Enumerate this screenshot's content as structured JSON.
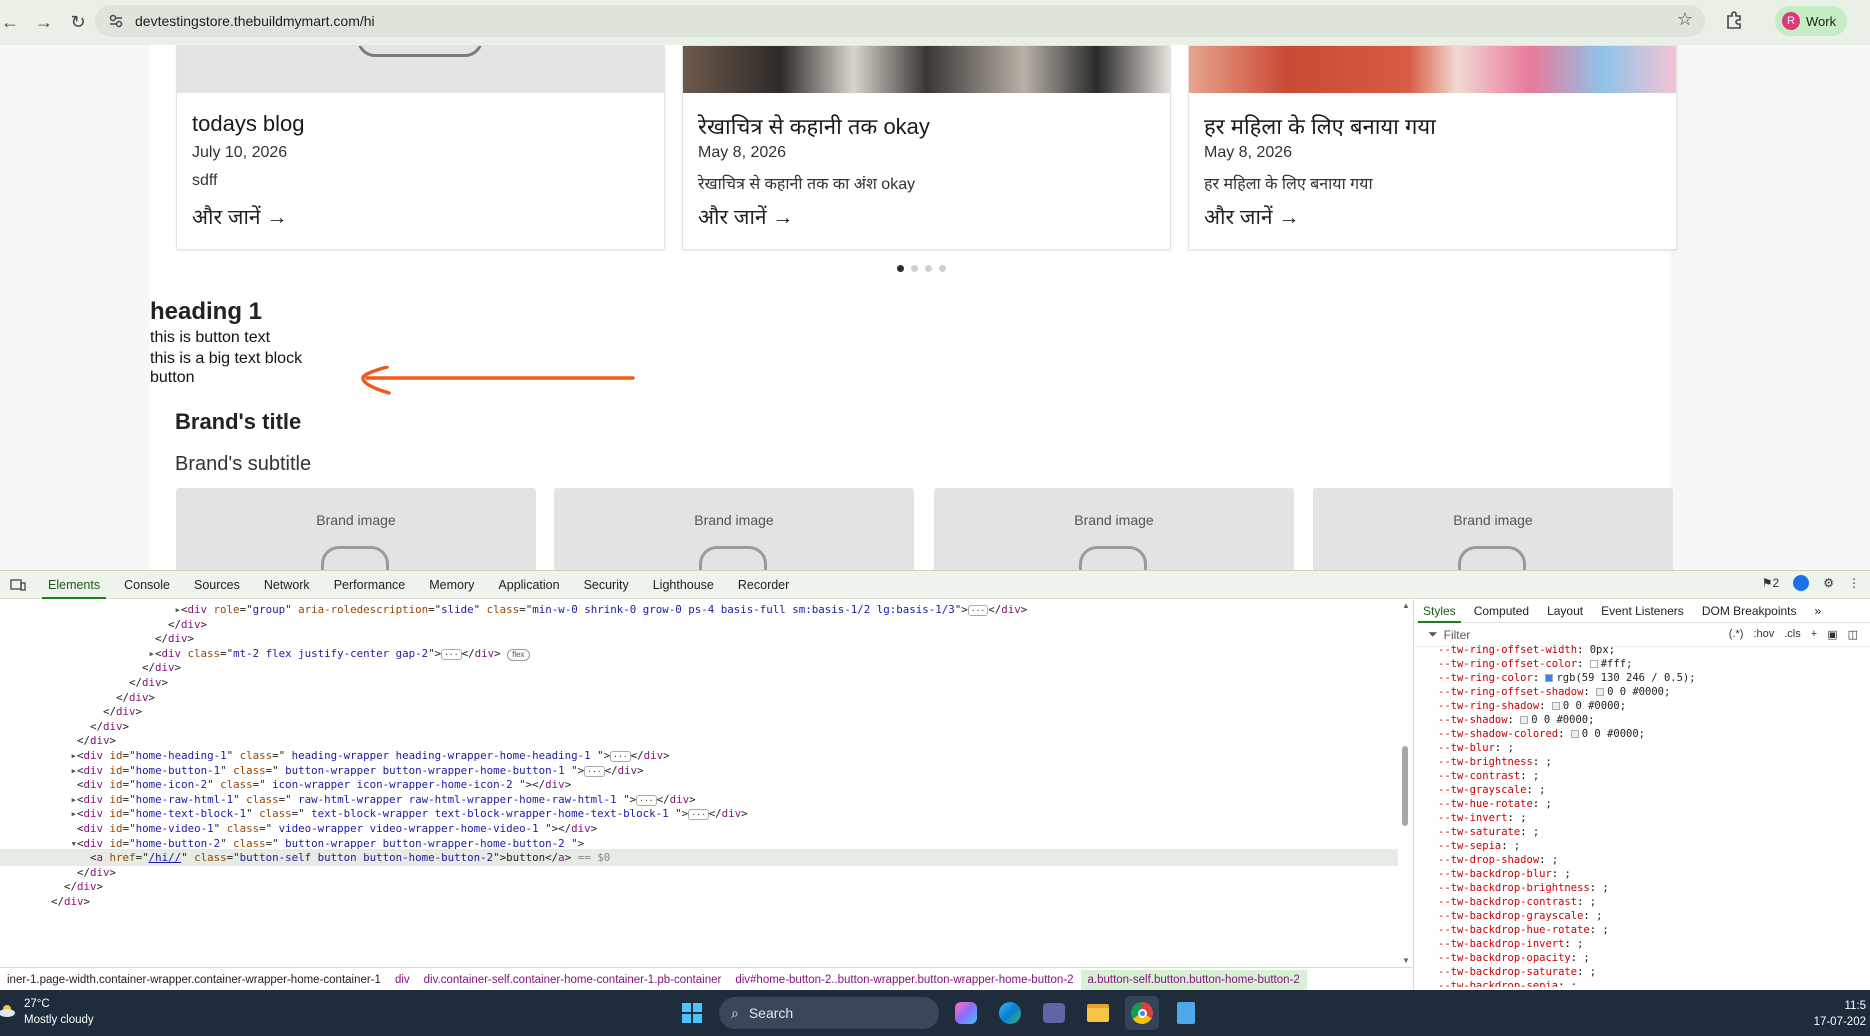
{
  "browser": {
    "url": "devtestingstore.thebuildmymart.com/hi",
    "profile_initial": "R",
    "profile_label": "Work"
  },
  "blog": {
    "cards": [
      {
        "title": "todays blog",
        "date": "July 10, 2026",
        "excerpt": "sdff",
        "more": "और जानें →"
      },
      {
        "title": "रेखाचित्र से कहानी तक okay",
        "date": "May 8, 2026",
        "excerpt": "रेखाचित्र से कहानी तक का अंश okay",
        "more": "और जानें →"
      },
      {
        "title": "हर महिला के लिए बनाया गया",
        "date": "May 8, 2026",
        "excerpt": "हर महिला के लिए बनाया गया",
        "more": "और जानें →"
      }
    ],
    "active_dot": 0,
    "dot_count": 4
  },
  "content": {
    "heading": "heading 1",
    "button_text": "this is button text",
    "text_block": "this is a big text block",
    "button": "button"
  },
  "brands": {
    "title": "Brand's title",
    "subtitle": "Brand's subtitle",
    "cards": [
      "Brand image",
      "Brand image",
      "Brand image",
      "Brand image"
    ]
  },
  "devtools": {
    "tabs": [
      "Elements",
      "Console",
      "Sources",
      "Network",
      "Performance",
      "Memory",
      "Application",
      "Security",
      "Lighthouse",
      "Recorder"
    ],
    "active_tab": "Elements",
    "issues_count": "2",
    "dom_lines": [
      {
        "indent": 26,
        "tri": "▸",
        "html": "&lt;<span class='tag'>div</span> <span class='attr'>role</span>=\"<span class='val'>group</span>\" <span class='attr'>aria-roledescription</span>=\"<span class='val'>slide</span>\" <span class='attr'>class</span>=\"<span class='val'>min-w-0 shrink-0 grow-0 ps-4 basis-full sm:basis-1/2 lg:basis-1/3</span>\"&gt;<span class='ell'>···</span>&lt;/<span class='tag'>div</span>&gt;"
      },
      {
        "indent": 24,
        "tri": "",
        "html": "&lt;/<span class='tag'>div</span>&gt;"
      },
      {
        "indent": 22,
        "tri": "",
        "html": "&lt;/<span class='tag'>div</span>&gt;"
      },
      {
        "indent": 22,
        "tri": "▸",
        "html": "&lt;<span class='tag'>div</span> <span class='attr'>class</span>=\"<span class='val'>mt-2 flex justify-center gap-2</span>\"&gt;<span class='ell'>···</span>&lt;/<span class='tag'>div</span>&gt; <span class='pill'>flex</span>"
      },
      {
        "indent": 20,
        "tri": "",
        "html": "&lt;/<span class='tag'>div</span>&gt;"
      },
      {
        "indent": 18,
        "tri": "",
        "html": "&lt;/<span class='tag'>div</span>&gt;"
      },
      {
        "indent": 16,
        "tri": "",
        "html": "&lt;/<span class='tag'>div</span>&gt;"
      },
      {
        "indent": 14,
        "tri": "",
        "html": "&lt;/<span class='tag'>div</span>&gt;"
      },
      {
        "indent": 12,
        "tri": "",
        "html": "&lt;/<span class='tag'>div</span>&gt;"
      },
      {
        "indent": 10,
        "tri": "",
        "html": "&lt;/<span class='tag'>div</span>&gt;"
      },
      {
        "indent": 10,
        "tri": "▸",
        "html": "&lt;<span class='tag'>div</span> <span class='attr'>id</span>=\"<span class='val'>home-heading-1</span>\" <span class='attr'>class</span>=\"<span class='val'> heading-wrapper heading-wrapper-home-heading-1 </span>\"&gt;<span class='ell'>···</span>&lt;/<span class='tag'>div</span>&gt;"
      },
      {
        "indent": 10,
        "tri": "▸",
        "html": "&lt;<span class='tag'>div</span> <span class='attr'>id</span>=\"<span class='val'>home-button-1</span>\" <span class='attr'>class</span>=\"<span class='val'> button-wrapper button-wrapper-home-button-1 </span>\"&gt;<span class='ell'>···</span>&lt;/<span class='tag'>div</span>&gt;"
      },
      {
        "indent": 10,
        "tri": "",
        "html": "&lt;<span class='tag'>div</span> <span class='attr'>id</span>=\"<span class='val'>home-icon-2</span>\" <span class='attr'>class</span>=\"<span class='val'> icon-wrapper icon-wrapper-home-icon-2 </span>\"&gt;&lt;/<span class='tag'>div</span>&gt;"
      },
      {
        "indent": 10,
        "tri": "▸",
        "html": "&lt;<span class='tag'>div</span> <span class='attr'>id</span>=\"<span class='val'>home-raw-html-1</span>\" <span class='attr'>class</span>=\"<span class='val'> raw-html-wrapper raw-html-wrapper-home-raw-html-1 </span>\"&gt;<span class='ell'>···</span>&lt;/<span class='tag'>div</span>&gt;"
      },
      {
        "indent": 10,
        "tri": "▸",
        "html": "&lt;<span class='tag'>div</span> <span class='attr'>id</span>=\"<span class='val'>home-text-block-1</span>\" <span class='attr'>class</span>=\"<span class='val'> text-block-wrapper text-block-wrapper-home-text-block-1 </span>\"&gt;<span class='ell'>···</span>&lt;/<span class='tag'>div</span>&gt;"
      },
      {
        "indent": 10,
        "tri": "",
        "html": "&lt;<span class='tag'>div</span> <span class='attr'>id</span>=\"<span class='val'>home-video-1</span>\" <span class='attr'>class</span>=\"<span class='val'> video-wrapper video-wrapper-home-video-1 </span>\"&gt;&lt;/<span class='tag'>div</span>&gt;"
      },
      {
        "indent": 10,
        "tri": "▾",
        "html": "&lt;<span class='tag'>div</span> <span class='attr'>id</span>=\"<span class='val'>home-button-2</span>\" <span class='attr'>class</span>=\"<span class='val'> button-wrapper button-wrapper-home-button-2 </span>\"&gt;"
      },
      {
        "indent": 12,
        "tri": "",
        "html": "&lt;<span class='tag'>a</span> <span class='attr'>href</span>=\"<span class='val' style='text-decoration:underline'>/hi//</span>\" <span class='attr'>class</span>=\"<span class='val'>button-self button button-home-button-2</span>\"&gt;button&lt;/<span class='tag'>a</span>&gt; <span style='color:#888'>== $0</span>",
        "selected": true
      },
      {
        "indent": 10,
        "tri": "",
        "html": "&lt;/<span class='tag'>div</span>&gt;"
      },
      {
        "indent": 8,
        "tri": "",
        "html": "&lt;/<span class='tag'>div</span>&gt;"
      },
      {
        "indent": 6,
        "tri": "",
        "html": "&lt;/<span class='tag'>div</span>&gt;"
      }
    ],
    "breadcrumbs": [
      "iner-1.page-width.container-wrapper.container-wrapper-home-container-1",
      "div",
      "div.container-self.container-home-container-1.pb-container",
      "div#home-button-2..button-wrapper.button-wrapper-home-button-2",
      "a.button-self.button.button-home-button-2"
    ],
    "styles_tabs": [
      "Styles",
      "Computed",
      "Layout",
      "Event Listeners",
      "DOM Breakpoints"
    ],
    "filter_placeholder": "Filter",
    "filter_tools": [
      ":hov",
      ".cls"
    ],
    "css_props": [
      {
        "p": "--tw-ring-offset-width",
        "v": "0px;"
      },
      {
        "p": "--tw-ring-offset-color",
        "v": "#fff;",
        "sw": "#ffffff"
      },
      {
        "p": "--tw-ring-color",
        "v": "rgb(59 130 246 / 0.5);",
        "sw": "#3b82f6"
      },
      {
        "p": "--tw-ring-offset-shadow",
        "v": "0 0 #0000;",
        "sw": "#eeeeee"
      },
      {
        "p": "--tw-ring-shadow",
        "v": "0 0 #0000;",
        "sw": "#eeeeee"
      },
      {
        "p": "--tw-shadow",
        "v": "0 0 #0000;",
        "sw": "#eeeeee"
      },
      {
        "p": "--tw-shadow-colored",
        "v": "0 0 #0000;",
        "sw": "#eeeeee"
      },
      {
        "p": "--tw-blur",
        "v": ";"
      },
      {
        "p": "--tw-brightness",
        "v": ";"
      },
      {
        "p": "--tw-contrast",
        "v": ";"
      },
      {
        "p": "--tw-grayscale",
        "v": ";"
      },
      {
        "p": "--tw-hue-rotate",
        "v": ";"
      },
      {
        "p": "--tw-invert",
        "v": ";"
      },
      {
        "p": "--tw-saturate",
        "v": ";"
      },
      {
        "p": "--tw-sepia",
        "v": ";"
      },
      {
        "p": "--tw-drop-shadow",
        "v": ";"
      },
      {
        "p": "--tw-backdrop-blur",
        "v": ";"
      },
      {
        "p": "--tw-backdrop-brightness",
        "v": ";"
      },
      {
        "p": "--tw-backdrop-contrast",
        "v": ";"
      },
      {
        "p": "--tw-backdrop-grayscale",
        "v": ";"
      },
      {
        "p": "--tw-backdrop-hue-rotate",
        "v": ";"
      },
      {
        "p": "--tw-backdrop-invert",
        "v": ";"
      },
      {
        "p": "--tw-backdrop-opacity",
        "v": ";"
      },
      {
        "p": "--tw-backdrop-saturate",
        "v": ";"
      },
      {
        "p": "--tw-backdrop-sepia",
        "v": ";"
      }
    ]
  },
  "taskbar": {
    "temp": "27°C",
    "weather": "Mostly cloudy",
    "search": "Search",
    "time": "11:5",
    "date": "17-07-202"
  }
}
